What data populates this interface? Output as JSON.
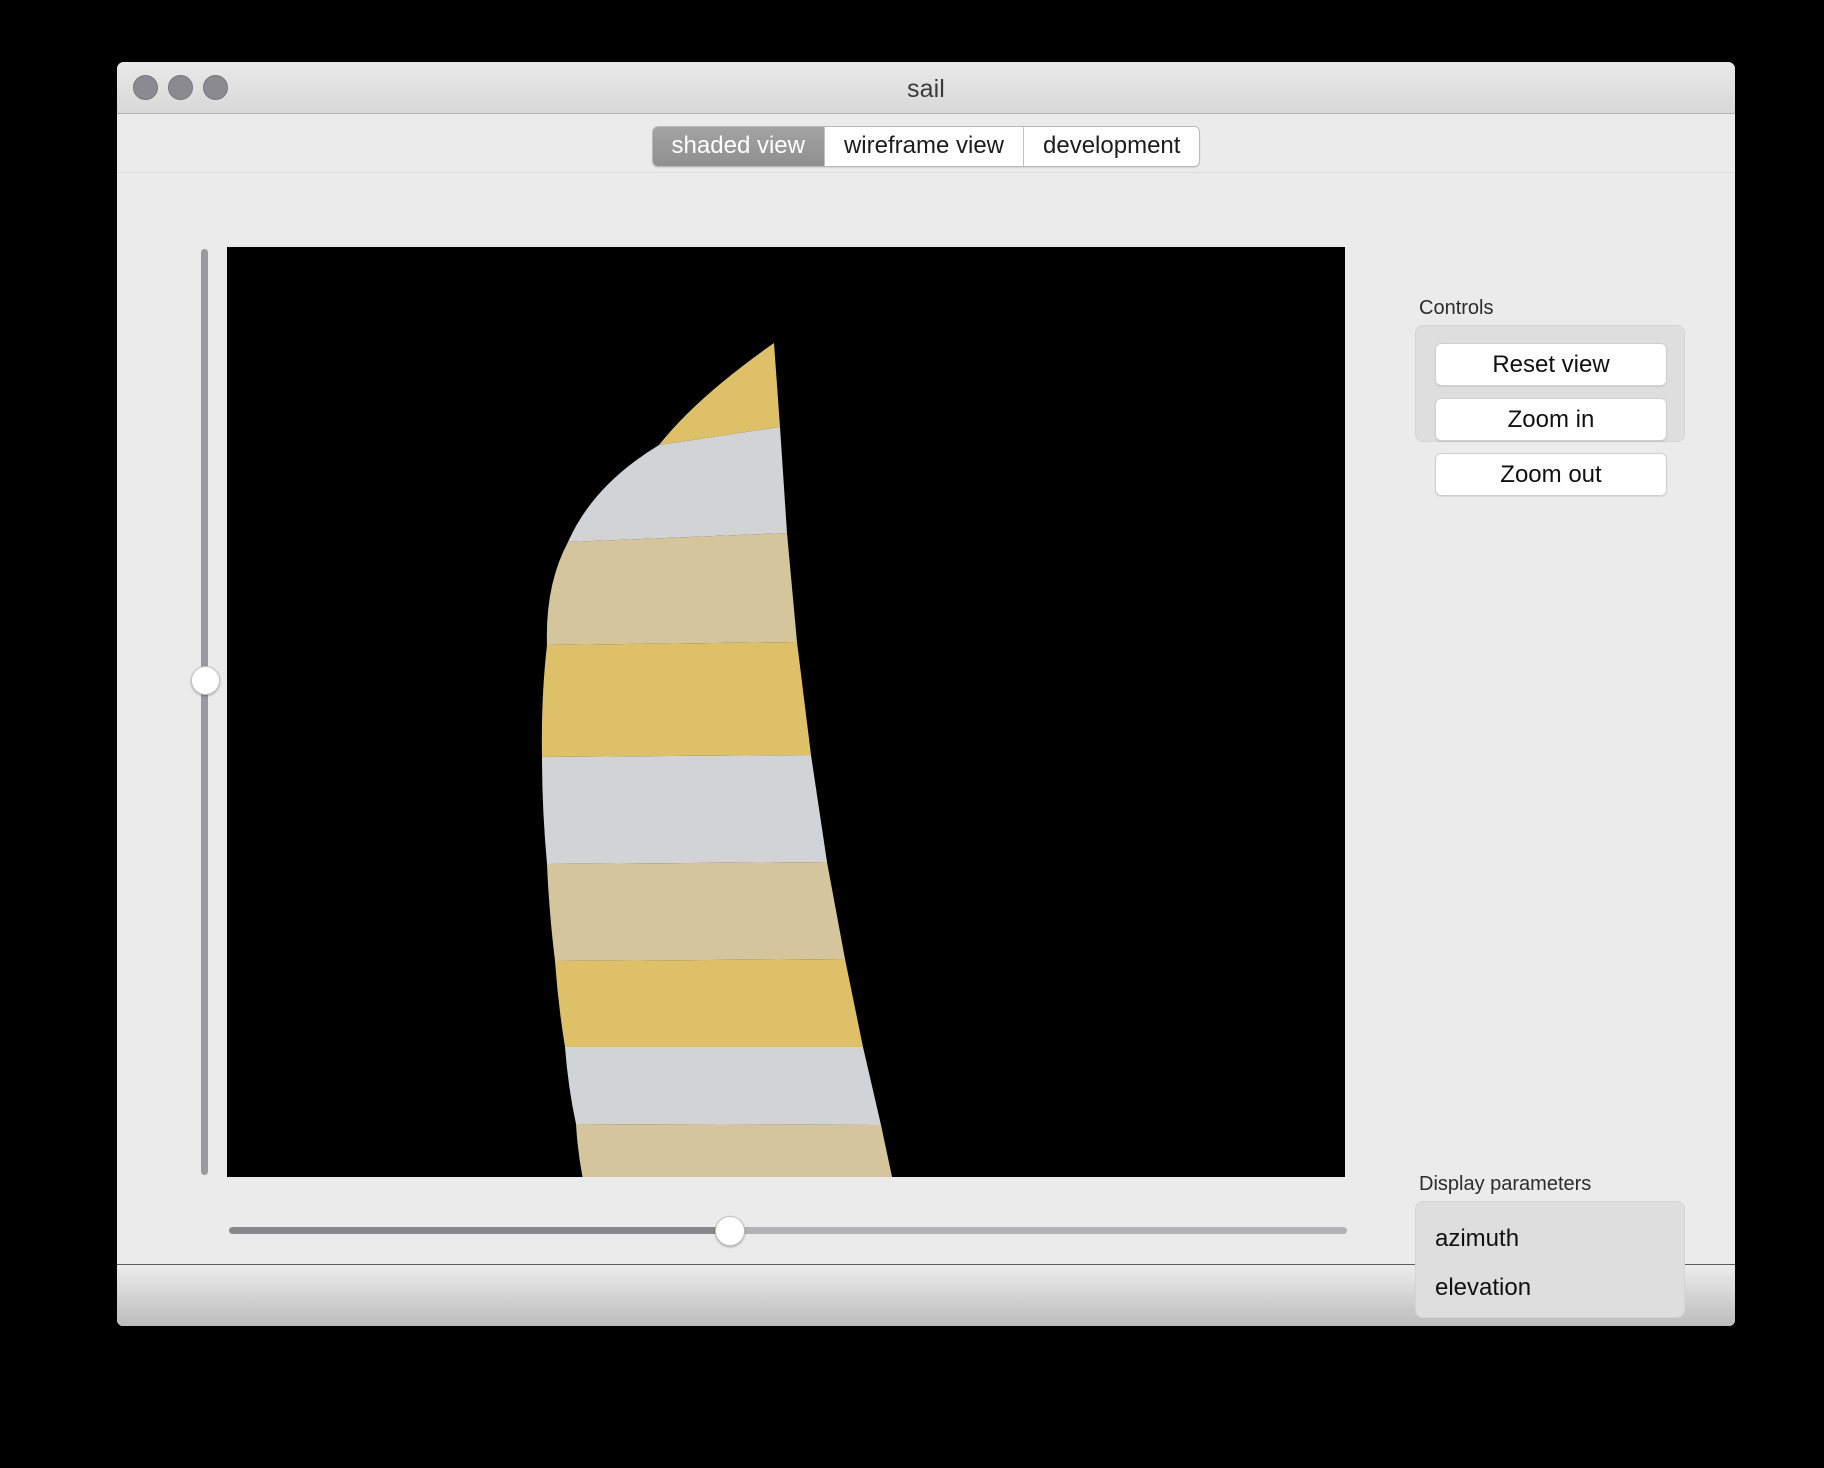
{
  "window": {
    "title": "sail",
    "traffic_lights": [
      "close-button",
      "minimize-button",
      "zoom-button"
    ]
  },
  "tabs": [
    {
      "label": "shaded view",
      "active": true
    },
    {
      "label": "wireframe view",
      "active": false
    },
    {
      "label": "development",
      "active": false
    }
  ],
  "controls": {
    "group_label": "Controls",
    "buttons": [
      {
        "label": "Reset view"
      },
      {
        "label": "Zoom in"
      },
      {
        "label": "Zoom out"
      }
    ]
  },
  "display_parameters": {
    "group_label": "Display parameters",
    "params": [
      {
        "label": "azimuth"
      },
      {
        "label": "elevation"
      }
    ]
  },
  "sliders": {
    "vertical": {
      "name": "elevation-slider",
      "value_fraction": 0.465
    },
    "horizontal": {
      "name": "azimuth-slider",
      "value_fraction": 0.435
    }
  },
  "viewport": {
    "background": "#000000",
    "render_label": "shaded-sail-render",
    "stripe_colors": [
      "#ddc067",
      "#d2d3d5",
      "#d4c59d",
      "#ddc067"
    ],
    "panels": [
      {
        "color": "#ddc067"
      },
      {
        "color": "#d2d3d5"
      },
      {
        "color": "#d4c59d"
      },
      {
        "color": "#ddc067"
      },
      {
        "color": "#d2d3d5"
      },
      {
        "color": "#d4c59d"
      },
      {
        "color": "#ddc067"
      },
      {
        "color": "#d2d3d5"
      },
      {
        "color": "#d4c59d"
      },
      {
        "color": "#ddc067"
      }
    ]
  },
  "colors": {
    "window_bg": "#ebebeb",
    "panel_bg": "#dededf",
    "active_tab_bg": "#9a9a9a",
    "canvas_bg": "#000000",
    "sail_gold": "#ddc067",
    "sail_gray": "#d2d3d5",
    "sail_tan": "#d4c59d"
  }
}
